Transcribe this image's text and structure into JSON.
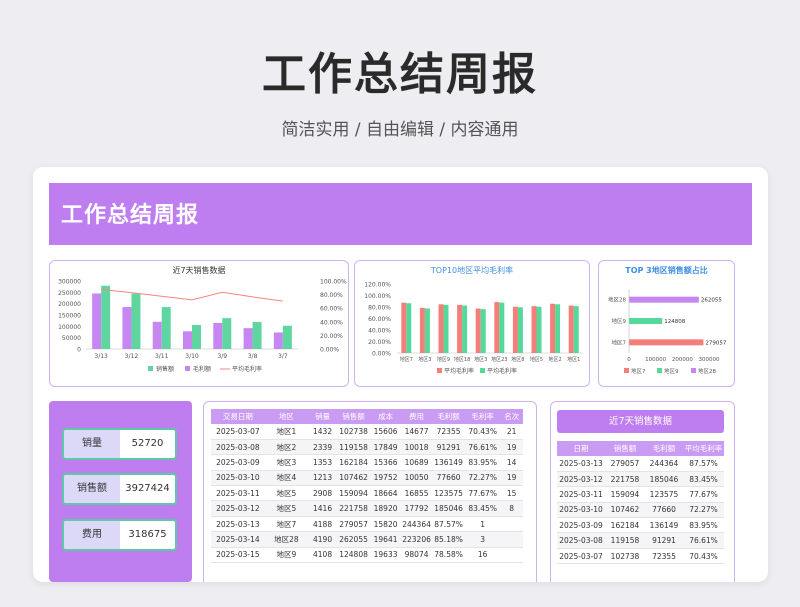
{
  "header": {
    "title": "工作总结周报",
    "subtitle": "简洁实用 / 自由编辑 / 内容通用"
  },
  "banner": {
    "title": "工作总结周报"
  },
  "colors": {
    "purple": "#bf7ef0",
    "bar_purple": "#c787f2",
    "bar_green": "#5fd6a0",
    "bar_red": "#f47f7a",
    "bar_green2": "#55d99a",
    "line_red": "#f4857f"
  },
  "charts": [
    {
      "type": "bar",
      "title": "近7天销售数据",
      "categories": [
        "3/13",
        "3/12",
        "3/11",
        "3/10",
        "3/9",
        "3/8",
        "3/7"
      ],
      "series": [
        {
          "name": "销售额",
          "values": [
            245000,
            185000,
            120000,
            78000,
            115000,
            92000,
            73000
          ]
        },
        {
          "name": "毛利额",
          "values": [
            279057,
            244364,
            185046,
            106000,
            136149,
            119158,
            102738
          ]
        },
        {
          "name": "平均毛利率",
          "values": [
            0.8757,
            0.83,
            0.7767,
            0.7227,
            0.8345,
            0.7661,
            0.7043
          ]
        }
      ],
      "left_ticks": [
        "300000",
        "250000",
        "200000",
        "150000",
        "100000",
        "50000",
        "0"
      ],
      "right_ticks": [
        "100.00%",
        "80.00%",
        "60.00%",
        "40.00%",
        "20.00%",
        "0.00%"
      ],
      "ylim": [
        0,
        300000
      ],
      "y2lim": [
        0,
        1
      ]
    },
    {
      "type": "bar",
      "title": "TOP10地区平均毛利率",
      "categories": [
        "地区7",
        "地区3",
        "地区9",
        "地区18",
        "地区3",
        "地区23",
        "地区8",
        "地区5",
        "地区2",
        "地区1"
      ],
      "series": [
        {
          "name": "平均毛利率",
          "values": [
            0.8757,
            0.7847,
            0.8467,
            0.8367,
            0.7727,
            0.8857,
            0.8047,
            0.8147,
            0.8567,
            0.8247
          ]
        },
        {
          "name": "平均毛利率",
          "values": [
            0.8657,
            0.7747,
            0.8367,
            0.8267,
            0.7627,
            0.8757,
            0.7947,
            0.8047,
            0.8467,
            0.8147
          ]
        }
      ],
      "ticks": [
        "120.00%",
        "100.00%",
        "80.00%",
        "60.00%",
        "40.00%",
        "20.00%",
        "0.00%"
      ],
      "ylim": [
        0,
        1.2
      ]
    },
    {
      "type": "bar",
      "title": "TOP 3地区销售额占比",
      "categories": [
        "地区28",
        "地区9",
        "地区7"
      ],
      "series": [
        {
          "name": "地区7",
          "values": [
            null,
            null,
            279057
          ]
        },
        {
          "name": "地区9",
          "values": [
            null,
            124808,
            null
          ]
        },
        {
          "name": "地区28",
          "values": [
            262055,
            null,
            null
          ]
        }
      ],
      "value_labels": [
        "262055",
        "124808",
        "279057"
      ],
      "ticks": [
        "0",
        "100000",
        "200000",
        "300000"
      ],
      "xlim": [
        0,
        300000
      ]
    }
  ],
  "kpis": [
    {
      "label": "销量",
      "value": "52720"
    },
    {
      "label": "销售额",
      "value": "3927424"
    },
    {
      "label": "费用",
      "value": "318675"
    }
  ],
  "table1": {
    "headers": [
      "交易日期",
      "地区",
      "销量",
      "销售额",
      "成本",
      "费用",
      "毛利额",
      "毛利率",
      "名次"
    ],
    "rows": [
      [
        "2025-03-07",
        "地区1",
        "1432",
        "102738",
        "15606",
        "14677",
        "72355",
        "70.43%",
        "21"
      ],
      [
        "2025-03-08",
        "地区2",
        "2339",
        "119158",
        "17849",
        "10018",
        "91291",
        "76.61%",
        "19"
      ],
      [
        "2025-03-09",
        "地区3",
        "1353",
        "162184",
        "15366",
        "10689",
        "136149",
        "83.95%",
        "14"
      ],
      [
        "2025-03-10",
        "地区4",
        "1213",
        "107462",
        "19752",
        "10050",
        "77660",
        "72.27%",
        "19"
      ],
      [
        "2025-03-11",
        "地区5",
        "2908",
        "159094",
        "18664",
        "16855",
        "123575",
        "77.67%",
        "15"
      ],
      [
        "2025-03-12",
        "地区5",
        "1416",
        "221758",
        "18920",
        "17792",
        "185046",
        "83.45%",
        "8"
      ],
      [
        "2025-03-13",
        "地区7",
        "4188",
        "279057",
        "15820",
        "244364",
        "87.57%",
        "1",
        ""
      ],
      [
        "2025-03-14",
        "地区28",
        "4190",
        "262055",
        "19641",
        "223206",
        "85.18%",
        "3",
        ""
      ],
      [
        "2025-03-15",
        "地区9",
        "4108",
        "124808",
        "19633",
        "98074",
        "78.58%",
        "16",
        ""
      ]
    ]
  },
  "table2": {
    "title": "近7天销售数据",
    "headers": [
      "日期",
      "销售额",
      "毛利额",
      "平均毛利率"
    ],
    "rows": [
      [
        "2025-03-13",
        "279057",
        "244364",
        "87.57%"
      ],
      [
        "2025-03-12",
        "221758",
        "185046",
        "83.45%"
      ],
      [
        "2025-03-11",
        "159094",
        "123575",
        "77.67%"
      ],
      [
        "2025-03-10",
        "107462",
        "77660",
        "72.27%"
      ],
      [
        "2025-03-09",
        "162184",
        "136149",
        "83.95%"
      ],
      [
        "2025-03-08",
        "119158",
        "91291",
        "76.61%"
      ],
      [
        "2025-03-07",
        "102738",
        "72355",
        "70.43%"
      ]
    ]
  }
}
